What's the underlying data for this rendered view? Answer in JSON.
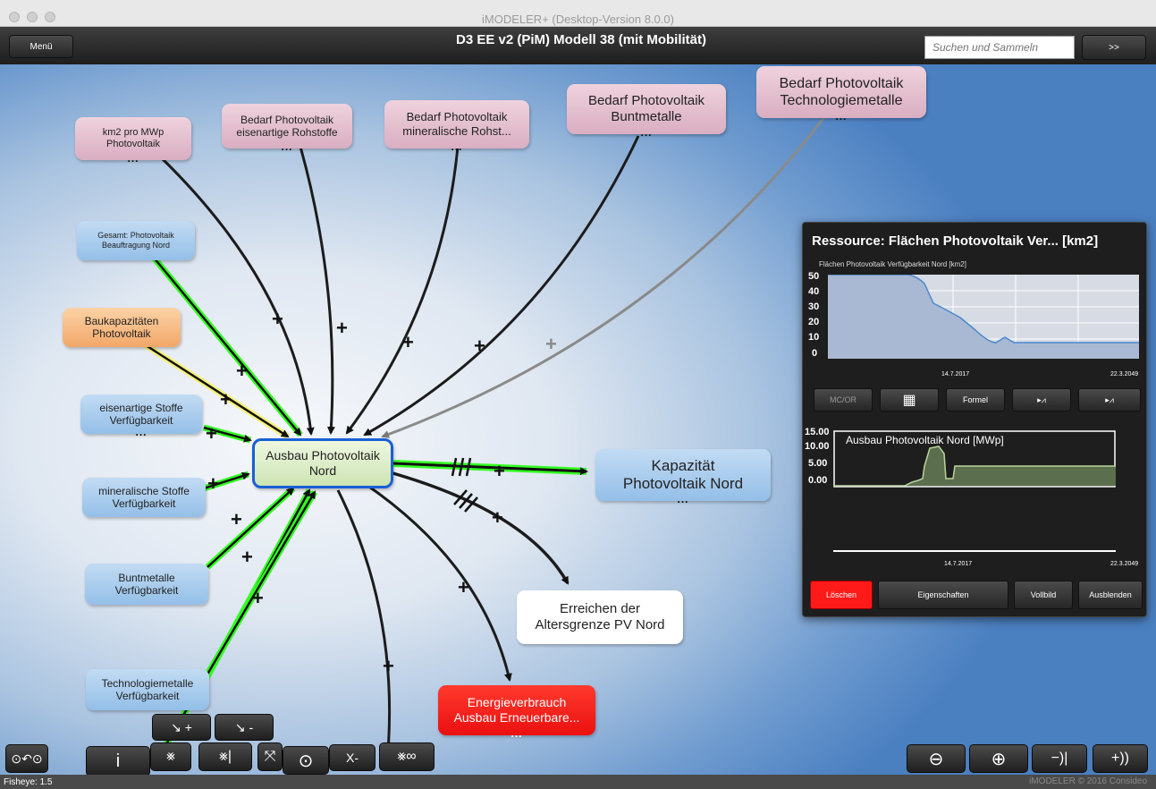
{
  "window": {
    "title": "iMODELER+ (Desktop-Version 8.0.0)"
  },
  "toolbar": {
    "menu_label": "Menü",
    "model_title": "D3 EE v2 (PiM) Modell 38 (mit Mobilität)",
    "search_placeholder": "Suchen und Sammeln",
    "search_go": ">>"
  },
  "nodes": {
    "km2": {
      "l1": "km2 pro MWp",
      "l2": "Photovoltaik"
    },
    "eisenartig_rohstoffe": {
      "l1": "Bedarf Photovoltaik",
      "l2": "eisenartige Rohstoffe"
    },
    "mineralische_rohst": {
      "l1": "Bedarf Photovoltaik",
      "l2": "mineralische Rohst..."
    },
    "buntmetalle": {
      "l1": "Bedarf Photovoltaik",
      "l2": "Buntmetalle"
    },
    "technologiemetalle": {
      "l1": "Bedarf Photovoltaik",
      "l2": "Technologiemetalle"
    },
    "gesamt_beauftragung": {
      "l1": "Gesamt: Photovoltaik",
      "l2": "Beauftragung Nord"
    },
    "baukapazitaeten": {
      "l1": "Baukapazitäten",
      "l2": "Photovoltaik"
    },
    "eisenartige_stoffe": {
      "l1": "eisenartige Stoffe",
      "l2": "Verfügbarkeit"
    },
    "mineralische_stoffe": {
      "l1": "mineralische Stoffe",
      "l2": "Verfügbarkeit"
    },
    "buntmetalle_verf": {
      "l1": "Buntmetalle",
      "l2": "Verfügbarkeit"
    },
    "technologiemetalle_verf": {
      "l1": "Technologiemetalle",
      "l2": "Verfügbarkeit"
    },
    "center": {
      "l1": "Ausbau Photovoltaik",
      "l2": "Nord"
    },
    "kapazitaet": {
      "l1": "Kapazität",
      "l2": "Photovoltaik Nord"
    },
    "altersgrenze": {
      "l1": "Erreichen der",
      "l2": "Altersgrenze PV Nord"
    },
    "energieverbrauch": {
      "l1": "Energieverbrauch",
      "l2": "Ausbau Erneuerbare..."
    }
  },
  "more_dots": "...",
  "edge_plus": "+",
  "panel": {
    "title": "Ressource: Flächen Photovoltaik Ver... [km2]",
    "chart1_label": "Flächen Photovoltaik Verfügbarkeit Nord [km2]",
    "chart1_yticks": [
      "50",
      "40",
      "30",
      "20",
      "10",
      "0"
    ],
    "chart2_label": "Ausbau Photovoltaik Nord [MWp]",
    "chart2_yticks": [
      "15.00",
      "10.00",
      "5.00",
      "0.00"
    ],
    "date_mid": "14.7.2017",
    "date_end": "22.3.2049",
    "buttons": {
      "mcor": "MC/OR",
      "formel": "Formel",
      "loeschen": "Löschen",
      "eigenschaften": "Eigenschaften",
      "vollbild": "Vollbild",
      "ausblenden": "Ausblenden"
    }
  },
  "controls": {
    "arrow_plus": "+",
    "arrow_minus": "-",
    "info": "i",
    "remove": "X-",
    "zoom_in": "−)|",
    "zoom_out": "+))"
  },
  "status": {
    "fisheye": "Fisheye: 1.5",
    "copyright": "iMODELER © 2016 Consideo"
  },
  "colors": {
    "accent_blue": "#1a5fd6",
    "delete_red": "#ff1a1a",
    "edge_green": "#33ff22"
  }
}
